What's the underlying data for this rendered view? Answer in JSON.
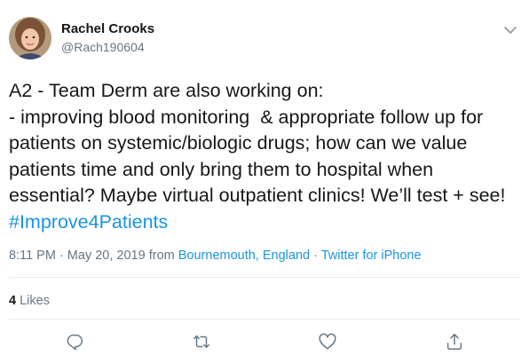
{
  "author": {
    "name": "Rachel Crooks",
    "handle": "@Rach190604"
  },
  "tweet": {
    "text": "A2 - Team Derm are also working on:\n- improving blood monitoring  & appropriate follow up for patients on systemic/biologic drugs; how can we value patients time and only bring them to hospital when essential? Maybe virtual outpatient clinics! We’ll test + see! ",
    "hashtag": "#Improve4Patients"
  },
  "meta": {
    "timestamp": "8:11 PM · May 20, 2019",
    "from_label": " from ",
    "location": "Bournemouth, England",
    "separator": " · ",
    "source": "Twitter for iPhone"
  },
  "engagement": {
    "likes_count": "4",
    "likes_label": " Likes"
  },
  "icons": {
    "menu": "chevron-down-icon",
    "reply": "reply-icon",
    "retweet": "retweet-icon",
    "like": "heart-icon",
    "share": "share-icon"
  },
  "colors": {
    "text": "#14171a",
    "secondary": "#657786",
    "link": "#1b95e0",
    "divider": "#e6ecf0"
  }
}
